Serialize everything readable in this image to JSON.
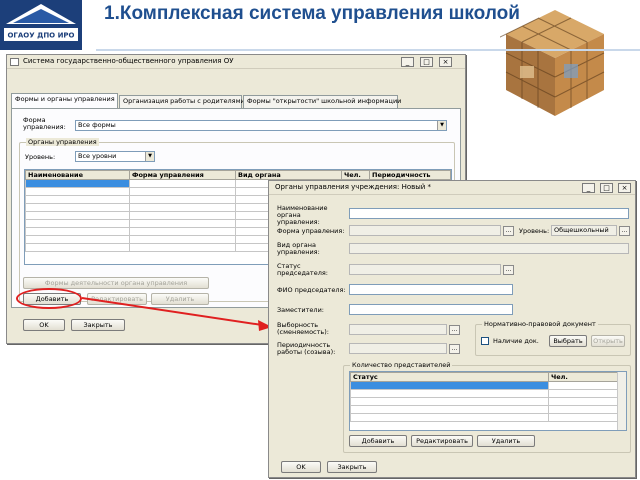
{
  "slide": {
    "logo_text": "ОГАОУ ДПО ИРО",
    "title": "1.Комплексная система управления школой"
  },
  "main_window": {
    "title": "Система государственно-общественного управления ОУ",
    "controls": {
      "minimize": "_",
      "maximize": "□",
      "close": "×"
    },
    "tabs": [
      {
        "label": "Формы и органы управления"
      },
      {
        "label": "Организация работы с родителями"
      },
      {
        "label": "Формы \"открытости\" школьной информации"
      }
    ],
    "form_label": "Форма управления:",
    "form_value": "Все формы",
    "group_title": "Органы управления",
    "level_label": "Уровень:",
    "level_value": "Все уровни",
    "table_headers": [
      "Наименование",
      "Форма управления",
      "Вид органа",
      "Чел.",
      "Периодичность"
    ],
    "activity_button": "Формы деятельности органа управления",
    "add_button": "Добавить",
    "edit_button": "Редактировать",
    "delete_button": "Удалить",
    "ok_button": "OK",
    "close_button": "Закрыть"
  },
  "dialog": {
    "title": "Органы управления учреждения: Новый *",
    "controls": {
      "minimize": "_",
      "maximize": "□",
      "close": "×"
    },
    "name_label": "Наименование органа управления:",
    "form_label": "Форма управления:",
    "level_label": "Уровень:",
    "level_value": "Общешкольный",
    "kind_label": "Вид органа управления:",
    "status_label": "Статус председателя:",
    "chair_label": "ФИО председателя:",
    "deputies_label": "Заместители:",
    "elect_label": "Выборность (сменяемость):",
    "period_label": "Периодичность работы (созыва):",
    "doc_group": "Нормативно-правовой документ",
    "doc_check_label": "Наличие док.",
    "doc_select": "Выбрать",
    "doc_open": "Открыть",
    "members_group": "Количество представителей",
    "members_headers": [
      "Статус",
      "Чел."
    ],
    "add_button": "Добавить",
    "edit_button": "Редактировать",
    "delete_button": "Удалить",
    "ok_button": "OK",
    "close_button": "Закрыть",
    "ellipsis": "..."
  }
}
